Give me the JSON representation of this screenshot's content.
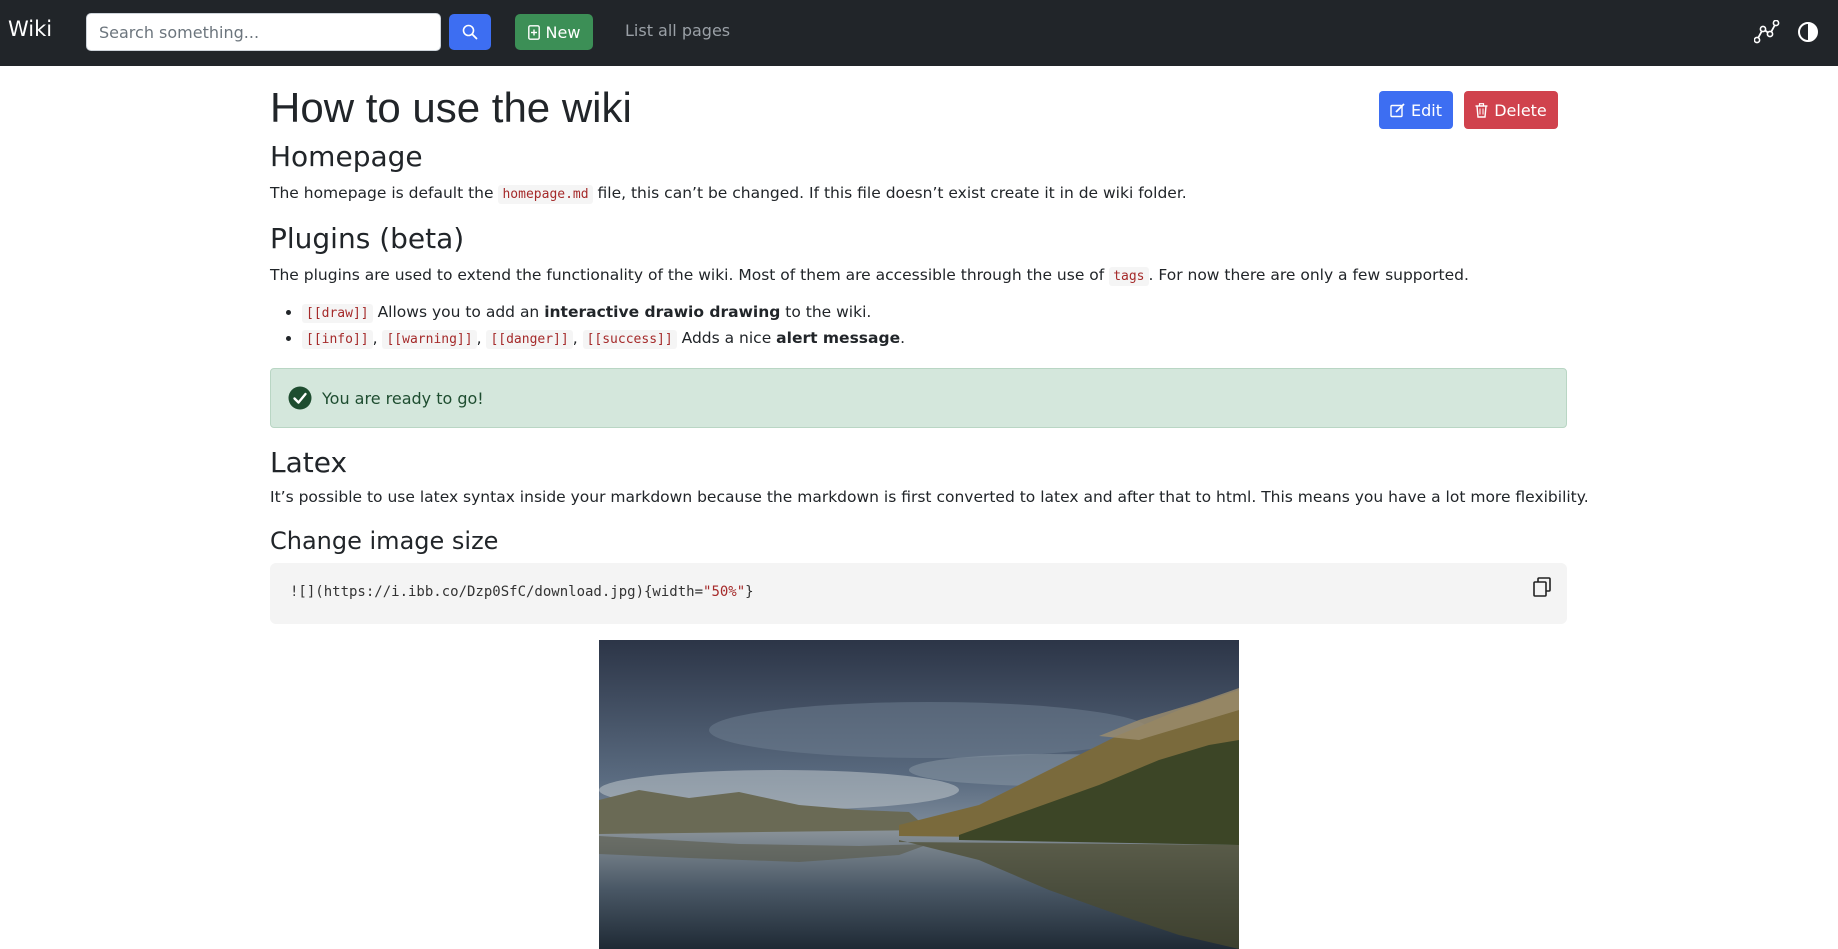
{
  "navbar": {
    "brand": "Wiki",
    "search_placeholder": "Search something...",
    "new_label": "New",
    "list_label": "List all pages"
  },
  "page": {
    "title": "How to use the wiki",
    "edit_label": "Edit",
    "delete_label": "Delete"
  },
  "sections": {
    "homepage": {
      "heading": "Homepage",
      "text_before": "The homepage is default the",
      "code": "homepage.md",
      "text_after": "file, this can’t be changed. If this file doesn’t exist create it in de wiki folder."
    },
    "plugins": {
      "heading": "Plugins (beta)",
      "text_before": "The plugins are used to extend the functionality of the wiki. Most of them are accessible through the use of",
      "code": "tags",
      "text_after": ". For now there are only a few supported.",
      "items": [
        {
          "codes": [
            "[[draw]]"
          ],
          "text": "Allows you to add an",
          "bold": "interactive drawio drawing",
          "tail": "to the wiki."
        },
        {
          "codes": [
            "[[info]]",
            "[[warning]]",
            "[[danger]]",
            "[[success]]"
          ],
          "text": "Adds a nice",
          "bold": "alert message",
          "tail": "."
        }
      ]
    },
    "alert": {
      "text": "You are ready to go!"
    },
    "latex": {
      "heading": "Latex",
      "text": "It’s possible to use latex syntax inside your markdown because the markdown is first converted to latex and after that to html. This means you have a lot more flexibility."
    },
    "image_size": {
      "heading": "Change image size",
      "code_prefix": "![](https://i.ibb.co/Dzp0SfC/download.jpg){width=",
      "code_string": "\"50%\"",
      "code_suffix": "}"
    }
  },
  "colors": {
    "navbar_bg": "#212529",
    "primary": "#3d6ef2",
    "success": "#3c8f56",
    "danger": "#d0424d",
    "alert_bg": "#d4e7dc"
  }
}
